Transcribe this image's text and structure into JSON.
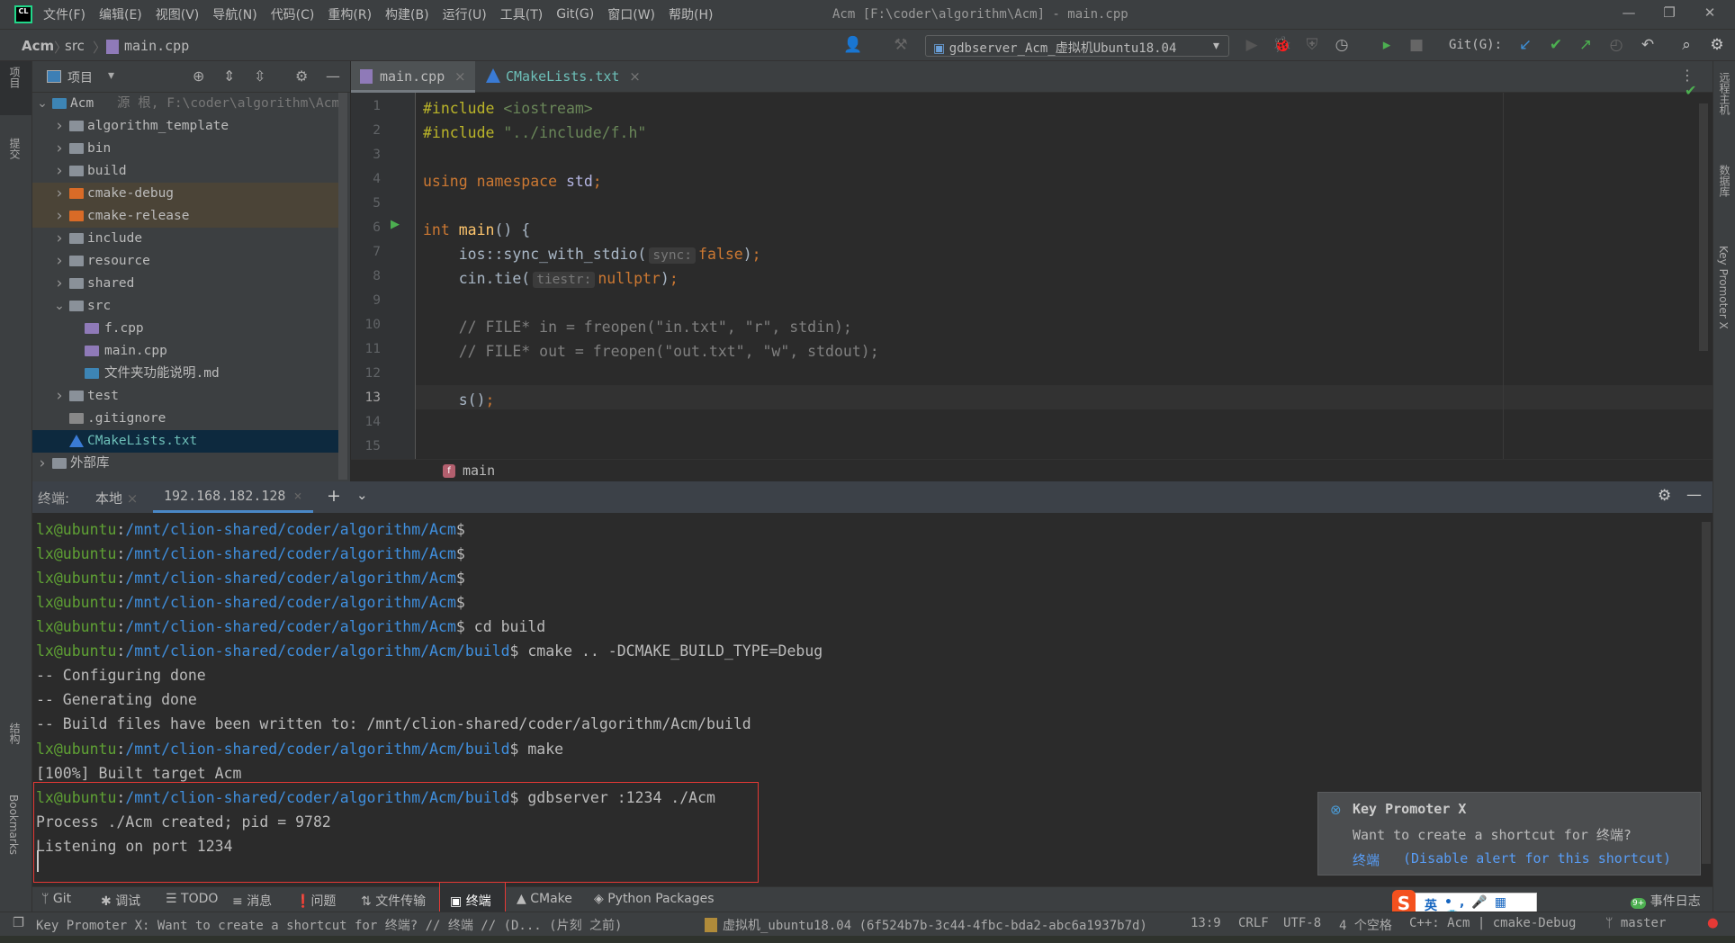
{
  "titlebar": {
    "menus": [
      "文件(F)",
      "编辑(E)",
      "视图(V)",
      "导航(N)",
      "代码(C)",
      "重构(R)",
      "构建(B)",
      "运行(U)",
      "工具(T)",
      "Git(G)",
      "窗口(W)",
      "帮助(H)"
    ],
    "title": "Acm [F:\\coder\\algorithm\\Acm] - main.cpp",
    "logo": "CL"
  },
  "navbar": {
    "breadcrumb": [
      "Acm",
      "src",
      "main.cpp"
    ],
    "run_config": "gdbserver_Acm_虚拟机Ubuntu18.04",
    "git_label": "Git(G):"
  },
  "left_stripe": {
    "items": [
      "项目",
      "提交",
      "结构",
      "Bookmarks"
    ]
  },
  "right_stripe": {
    "items": [
      "远程主机",
      "数据库",
      "Key Promoter X"
    ]
  },
  "project": {
    "title": "项目",
    "tree": [
      {
        "label": "Acm",
        "extra": "源 根, F:\\coder\\algorithm\\Acm",
        "depth": 0,
        "type": "module",
        "expanded": true
      },
      {
        "label": "algorithm_template",
        "depth": 1,
        "type": "folder"
      },
      {
        "label": "bin",
        "depth": 1,
        "type": "folder"
      },
      {
        "label": "build",
        "depth": 1,
        "type": "folder"
      },
      {
        "label": "cmake-debug",
        "depth": 1,
        "type": "excluded",
        "highlight": true
      },
      {
        "label": "cmake-release",
        "depth": 1,
        "type": "excluded",
        "highlight": true
      },
      {
        "label": "include",
        "depth": 1,
        "type": "folder"
      },
      {
        "label": "resource",
        "depth": 1,
        "type": "folder"
      },
      {
        "label": "shared",
        "depth": 1,
        "type": "folder"
      },
      {
        "label": "src",
        "depth": 1,
        "type": "folder",
        "expanded": true
      },
      {
        "label": "f.cpp",
        "depth": 2,
        "type": "cpp"
      },
      {
        "label": "main.cpp",
        "depth": 2,
        "type": "cpp"
      },
      {
        "label": "文件夹功能说明.md",
        "depth": 2,
        "type": "md"
      },
      {
        "label": "test",
        "depth": 1,
        "type": "folder"
      },
      {
        "label": ".gitignore",
        "depth": 1,
        "type": "ignore"
      },
      {
        "label": "CMakeLists.txt",
        "depth": 1,
        "type": "cmake",
        "selected": true
      },
      {
        "label": "外部库",
        "depth": 0,
        "type": "lib"
      }
    ]
  },
  "editor": {
    "tabs": [
      {
        "label": "main.cpp",
        "active": true
      },
      {
        "label": "CMakeLists.txt",
        "active": false
      }
    ],
    "current_line": 13,
    "lines": [
      [
        [
          "pre",
          "#include "
        ],
        [
          "str",
          "<iostream>"
        ]
      ],
      [
        [
          "pre",
          "#include "
        ],
        [
          "str",
          "\"../include/f.h\""
        ]
      ],
      [],
      [
        [
          "kw",
          "using namespace "
        ],
        [
          "ns",
          "std"
        ],
        [
          "kw",
          ";"
        ]
      ],
      [],
      [
        [
          "kw",
          "int "
        ],
        [
          "fn",
          "main"
        ],
        [
          "id",
          "() {"
        ]
      ],
      [
        [
          "id",
          "    ios::sync_with_stdio("
        ],
        [
          "hint",
          "sync:"
        ],
        [
          "kw",
          "false"
        ],
        [
          "id",
          ")"
        ],
        [
          "kw",
          ";"
        ]
      ],
      [
        [
          "id",
          "    cin.tie("
        ],
        [
          "hint",
          "tiestr:"
        ],
        [
          "kw",
          "nullptr"
        ],
        [
          "id",
          ")"
        ],
        [
          "kw",
          ";"
        ]
      ],
      [],
      [
        [
          "cmt",
          "    // FILE* in = freopen(\"in.txt\", \"r\", stdin);"
        ]
      ],
      [
        [
          "cmt",
          "    // FILE* out = freopen(\"out.txt\", \"w\", stdout);"
        ]
      ],
      [],
      [
        [
          "id",
          "    s()"
        ],
        [
          "kw",
          ";"
        ]
      ],
      [],
      []
    ],
    "breadcrumb_fn": "main"
  },
  "terminal": {
    "label": "终端:",
    "tabs": [
      {
        "label": "本地",
        "active": false
      },
      {
        "label": "192.168.182.128",
        "active": true
      }
    ],
    "lines": [
      {
        "user": "lx@ubuntu",
        "path": "/mnt/clion-shared/coder/algorithm/Acm",
        "cmd": ""
      },
      {
        "user": "lx@ubuntu",
        "path": "/mnt/clion-shared/coder/algorithm/Acm",
        "cmd": ""
      },
      {
        "user": "lx@ubuntu",
        "path": "/mnt/clion-shared/coder/algorithm/Acm",
        "cmd": ""
      },
      {
        "user": "lx@ubuntu",
        "path": "/mnt/clion-shared/coder/algorithm/Acm",
        "cmd": ""
      },
      {
        "user": "lx@ubuntu",
        "path": "/mnt/clion-shared/coder/algorithm/Acm",
        "cmd": " cd build"
      },
      {
        "user": "lx@ubuntu",
        "path": "/mnt/clion-shared/coder/algorithm/Acm/build",
        "cmd": " cmake .. -DCMAKE_BUILD_TYPE=Debug"
      },
      {
        "text": "-- Configuring done"
      },
      {
        "text": "-- Generating done"
      },
      {
        "text": "-- Build files have been written to: /mnt/clion-shared/coder/algorithm/Acm/build"
      },
      {
        "user": "lx@ubuntu",
        "path": "/mnt/clion-shared/coder/algorithm/Acm/build",
        "cmd": " make"
      },
      {
        "text": "[100%] Built target Acm"
      },
      {
        "user": "lx@ubuntu",
        "path": "/mnt/clion-shared/coder/algorithm/Acm/build",
        "cmd": " gdbserver :1234 ./Acm"
      },
      {
        "text": "Process ./Acm created; pid = 9782"
      },
      {
        "text": "Listening on port 1234"
      }
    ]
  },
  "popup": {
    "title": "Key Promoter X",
    "message": "Want to create a shortcut for 终端?",
    "link1": "终端",
    "link2": "(Disable alert for this shortcut)"
  },
  "toolwindows": [
    "Git",
    "调试",
    "TODO",
    "消息",
    "问题",
    "文件传输",
    "终端",
    "CMake",
    "Python Packages"
  ],
  "event_log": {
    "label": "事件日志",
    "badge": "9+"
  },
  "statusbar": {
    "message": "Key Promoter X: Want to create a shortcut for 终端? // 终端 // (D... (片刻 之前)",
    "deployment": "虚拟机_ubuntu18.04 (6f524b7b-3c44-4fbc-bda2-abc6a1937b7d)",
    "position": "13:9",
    "line_sep": "CRLF",
    "encoding": "UTF-8",
    "indent": "4 个空格",
    "context": "C++: Acm | cmake-Debug",
    "branch": "master"
  },
  "ime": {
    "lang": "英"
  },
  "colors": {
    "accent": "#4a88c7",
    "prompt_user": "#5fa134",
    "prompt_path": "#3f8fde",
    "highlight_red": "#e53935"
  }
}
